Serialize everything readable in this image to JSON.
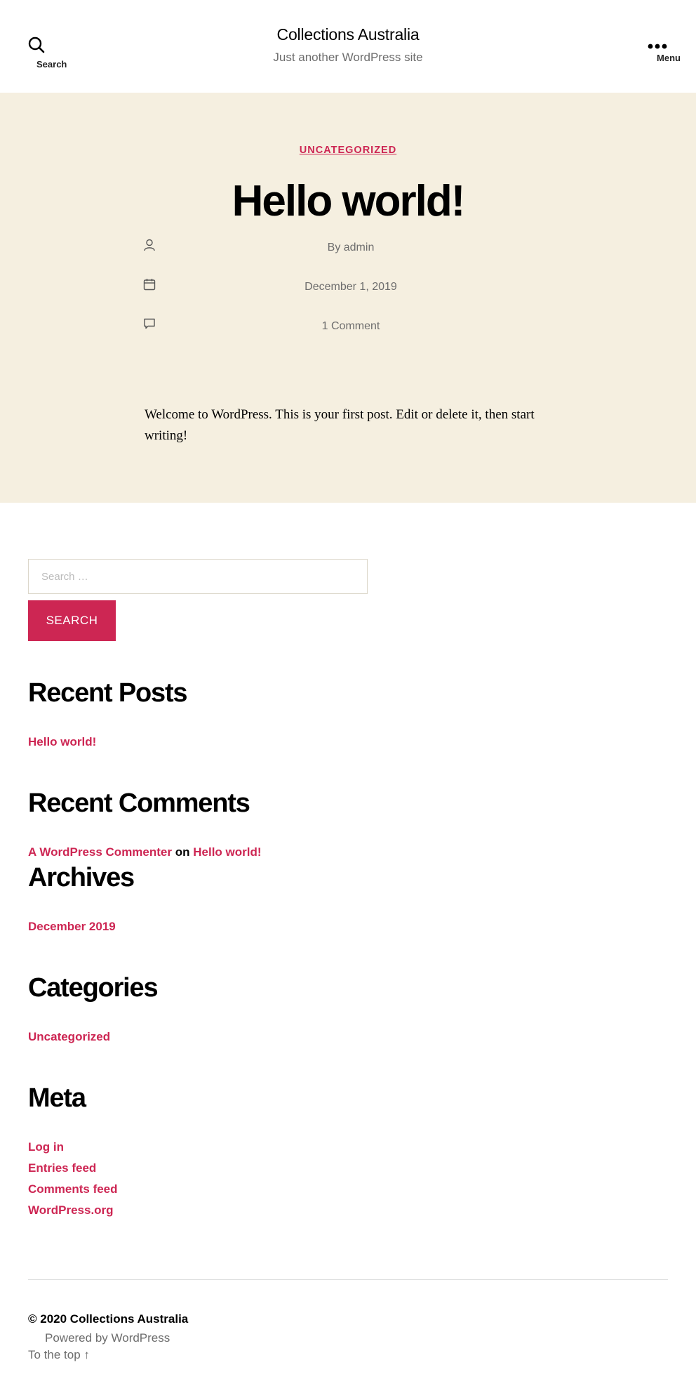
{
  "header": {
    "search_label": "Search",
    "site_title": "Collections Australia",
    "site_description": "Just another WordPress site",
    "menu_label": "Menu"
  },
  "post": {
    "category": "Uncategorized",
    "title": "Hello world!",
    "author_text": "By admin",
    "date": "December 1, 2019",
    "comments": "1 Comment",
    "content": "Welcome to WordPress. This is your first post. Edit or delete it, then start writing!"
  },
  "sidebar": {
    "search_placeholder": "Search …",
    "search_button": "Search",
    "recent_posts": {
      "heading": "Recent Posts",
      "items": [
        "Hello world!"
      ]
    },
    "recent_comments": {
      "heading": "Recent Comments",
      "author": "A WordPress Commenter",
      "connector": "on",
      "post": "Hello world!"
    },
    "archives": {
      "heading": "Archives",
      "items": [
        "December 2019"
      ]
    },
    "categories": {
      "heading": "Categories",
      "items": [
        "Uncategorized"
      ]
    },
    "meta": {
      "heading": "Meta",
      "items": [
        "Log in",
        "Entries feed",
        "Comments feed",
        "WordPress.org"
      ]
    }
  },
  "footer": {
    "copyright": "© 2020 Collections Australia",
    "powered_by": "Powered by WordPress",
    "to_top": "To the top ↑"
  },
  "colors": {
    "accent": "#cd2653",
    "hero_background": "#f5efe0",
    "muted_text": "#6d6d6d"
  }
}
